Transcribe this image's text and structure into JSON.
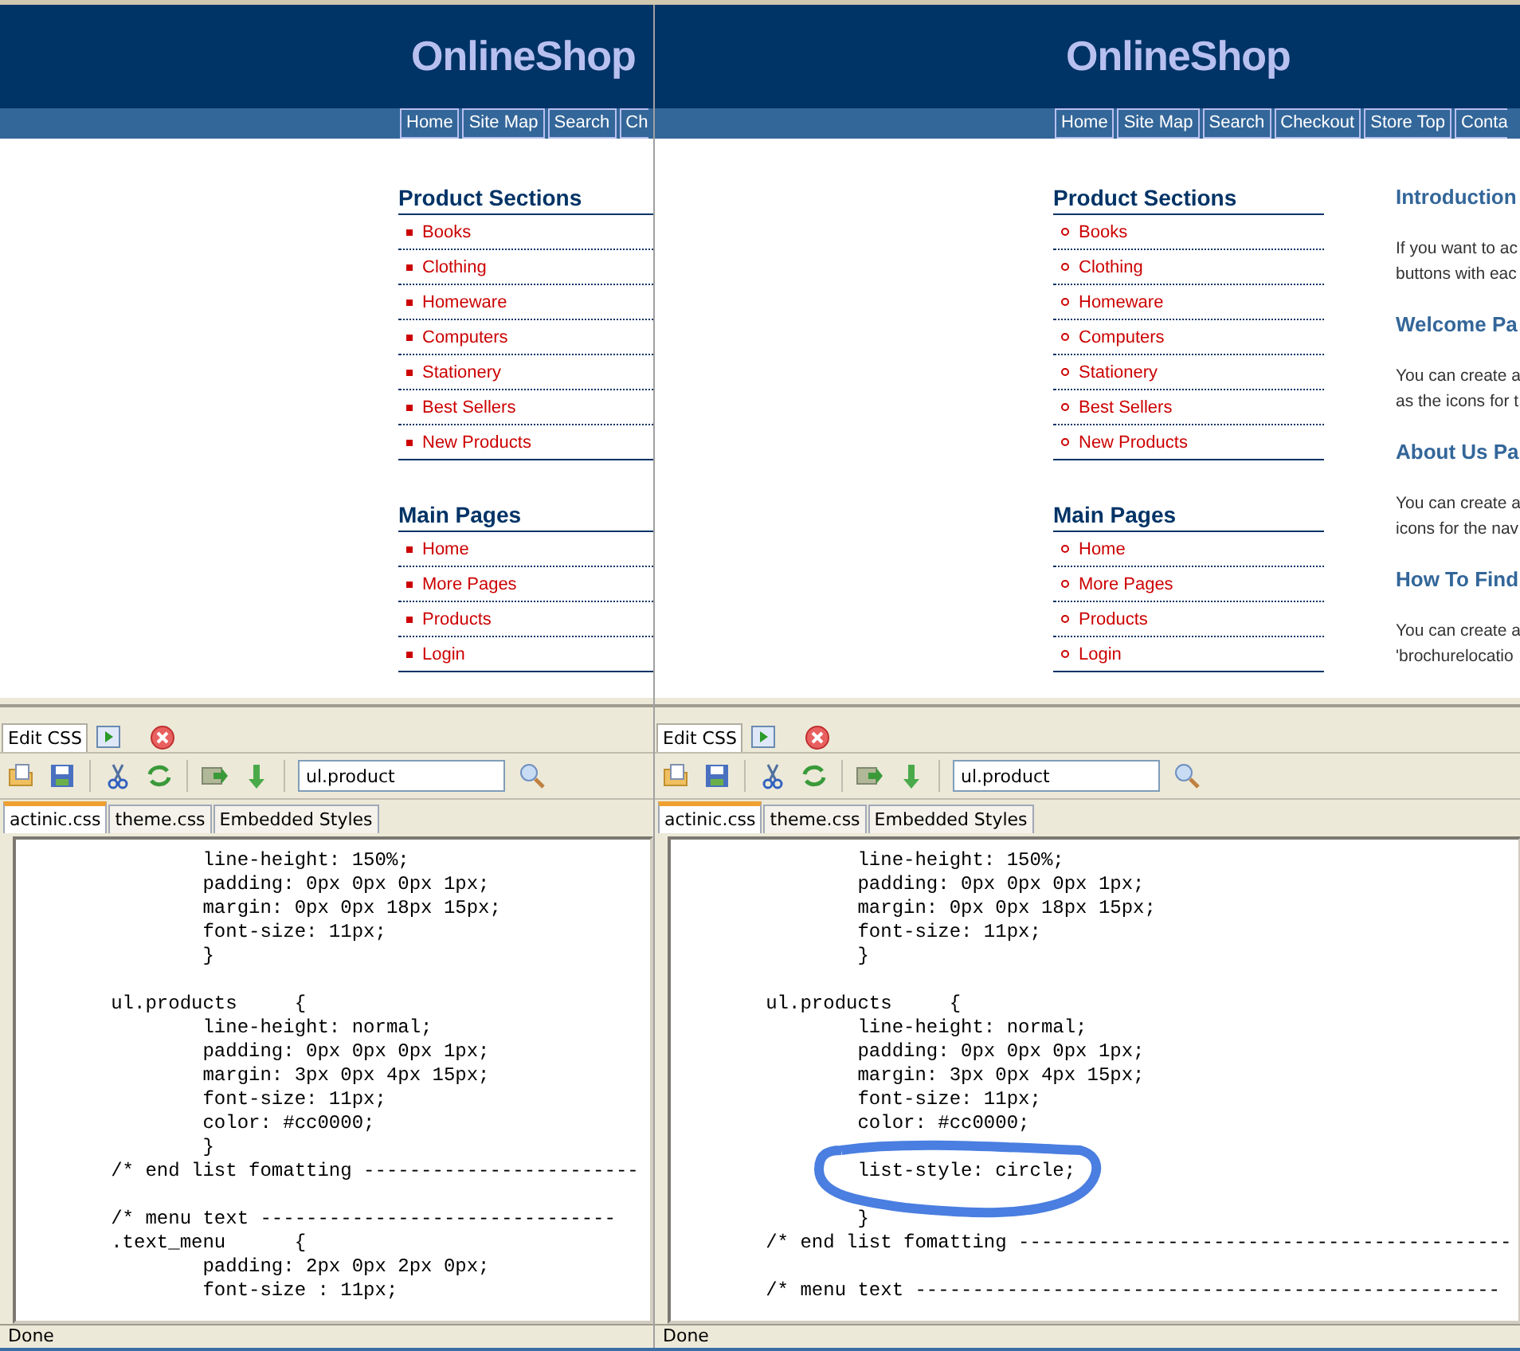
{
  "panes": [
    {
      "site": {
        "logo": "OnlineShop",
        "nav": [
          "Home",
          "Site Map",
          "Search",
          "Ch"
        ],
        "hollow_bullets": false,
        "sections": [
          {
            "title": "Product Sections",
            "items": [
              "Books",
              "Clothing",
              "Homeware",
              "Computers",
              "Stationery",
              "Best Sellers",
              "New Products"
            ]
          },
          {
            "title": "Main Pages",
            "items": [
              "Home",
              "More Pages",
              "Products",
              "Login"
            ]
          }
        ]
      },
      "editor": {
        "tab": "Edit CSS",
        "search": "ul.product",
        "files": [
          {
            "label": "actinic.css",
            "selected": true
          },
          {
            "label": "theme.css",
            "selected": false
          },
          {
            "label": "Embedded Styles",
            "selected": false
          }
        ],
        "lines": [
          {
            "kind": "code",
            "text": "                line-height: 150%;",
            "circled": false
          },
          {
            "kind": "code",
            "text": "                padding: 0px 0px 0px 1px;",
            "circled": false
          },
          {
            "kind": "code",
            "text": "                margin: 0px 0px 18px 15px;",
            "circled": false
          },
          {
            "kind": "code",
            "text": "                font-size: 11px;",
            "circled": false
          },
          {
            "kind": "code",
            "text": "                }",
            "circled": false
          },
          {
            "kind": "blank"
          },
          {
            "kind": "code",
            "text": "        ul.products     {",
            "circled": false
          },
          {
            "kind": "code",
            "text": "                line-height: normal;",
            "circled": false
          },
          {
            "kind": "code",
            "text": "                padding: 0px 0px 0px 1px;",
            "circled": false
          },
          {
            "kind": "code",
            "text": "                margin: 3px 0px 4px 15px;",
            "circled": false
          },
          {
            "kind": "code",
            "text": "                font-size: 11px;",
            "circled": false
          },
          {
            "kind": "code",
            "text": "                color: #cc0000;",
            "circled": false
          },
          {
            "kind": "code",
            "text": "                }",
            "circled": false
          },
          {
            "kind": "code",
            "text": "        /* end list fomatting ------------------------",
            "circled": false
          },
          {
            "kind": "blank"
          },
          {
            "kind": "code",
            "text": "        /* menu text -------------------------------",
            "circled": false
          },
          {
            "kind": "code",
            "text": "        .text_menu      {",
            "circled": false
          },
          {
            "kind": "code",
            "text": "                padding: 2px 0px 2px 0px;",
            "circled": false
          },
          {
            "kind": "code",
            "text": "                font-size : 11px;",
            "circled": false
          }
        ]
      },
      "status": "Done"
    },
    {
      "site": {
        "logo": "OnlineShop",
        "nav": [
          "Home",
          "Site Map",
          "Search",
          "Checkout",
          "Store Top",
          "Conta"
        ],
        "hollow_bullets": true,
        "sections": [
          {
            "title": "Product Sections",
            "items": [
              "Books",
              "Clothing",
              "Homeware",
              "Computers",
              "Stationery",
              "Best Sellers",
              "New Products"
            ]
          },
          {
            "title": "Main Pages",
            "items": [
              "Home",
              "More Pages",
              "Products",
              "Login"
            ]
          }
        ],
        "articles": [
          {
            "title": "Introduction",
            "text": [
              "If you want to ac",
              "buttons with eac"
            ]
          },
          {
            "title": "Welcome Pa",
            "text": [
              "You can create a",
              "as the icons for t"
            ]
          },
          {
            "title": "About Us Pa",
            "text": [
              "You can create a",
              "icons for the nav"
            ]
          },
          {
            "title": "How To Find",
            "text": [
              "You can create a",
              "'brochurelocatio"
            ]
          }
        ]
      },
      "editor": {
        "tab": "Edit CSS",
        "search": "ul.product",
        "files": [
          {
            "label": "actinic.css",
            "selected": true
          },
          {
            "label": "theme.css",
            "selected": false
          },
          {
            "label": "Embedded Styles",
            "selected": false
          }
        ],
        "lines": [
          {
            "kind": "code",
            "text": "                line-height: 150%;",
            "circled": false
          },
          {
            "kind": "code",
            "text": "                padding: 0px 0px 0px 1px;",
            "circled": false
          },
          {
            "kind": "code",
            "text": "                margin: 0px 0px 18px 15px;",
            "circled": false
          },
          {
            "kind": "code",
            "text": "                font-size: 11px;",
            "circled": false
          },
          {
            "kind": "code",
            "text": "                }",
            "circled": false
          },
          {
            "kind": "blank"
          },
          {
            "kind": "code",
            "text": "        ul.products     {",
            "circled": false
          },
          {
            "kind": "code",
            "text": "                line-height: normal;",
            "circled": false
          },
          {
            "kind": "code",
            "text": "                padding: 0px 0px 0px 1px;",
            "circled": false
          },
          {
            "kind": "code",
            "text": "                margin: 3px 0px 4px 15px;",
            "circled": false
          },
          {
            "kind": "code",
            "text": "                font-size: 11px;",
            "circled": false
          },
          {
            "kind": "code",
            "text": "                color: #cc0000;",
            "circled": false
          },
          {
            "kind": "blank"
          },
          {
            "kind": "code",
            "text": "                list-style: circle;",
            "circled": true
          },
          {
            "kind": "blank"
          },
          {
            "kind": "code",
            "text": "                }",
            "circled": false
          },
          {
            "kind": "code",
            "text": "        /* end list fomatting -------------------------------------------",
            "circled": false
          },
          {
            "kind": "blank"
          },
          {
            "kind": "code",
            "text": "        /* menu text ---------------------------------------------------",
            "circled": false
          }
        ]
      },
      "status": "Done"
    }
  ]
}
